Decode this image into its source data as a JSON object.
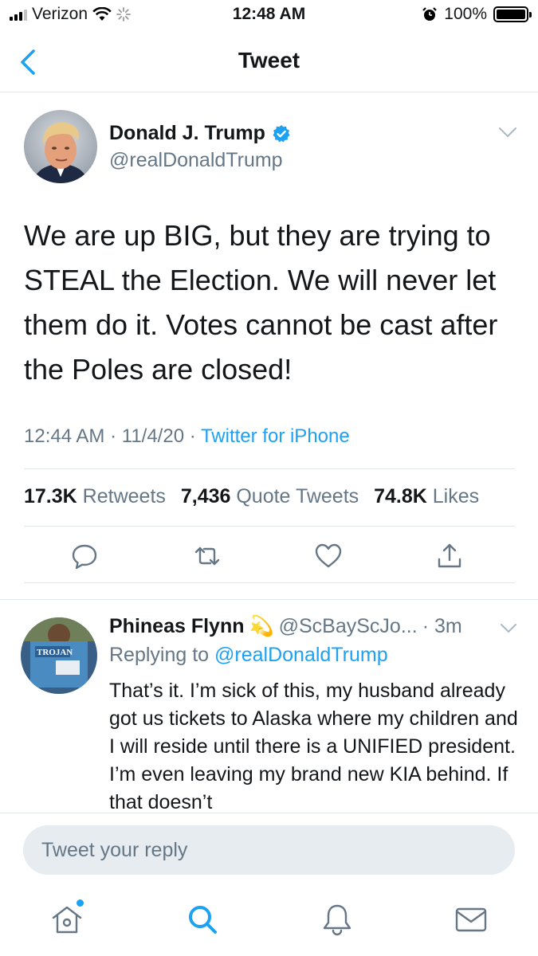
{
  "status_bar": {
    "carrier": "Verizon",
    "time": "12:48 AM",
    "battery": "100%"
  },
  "nav": {
    "title": "Tweet"
  },
  "tweet": {
    "author_name": "Donald J. Trump",
    "author_handle": "@realDonaldTrump",
    "text": "We are up BIG, but they are trying to STEAL the Election. We will never let them do it. Votes cannot be cast after the Poles are closed!",
    "time": "12:44 AM",
    "date": "11/4/20",
    "source": "Twitter for iPhone",
    "retweets_count": "17.3K",
    "retweets_label": "Retweets",
    "quote_count": "7,436",
    "quote_label": "Quote Tweets",
    "likes_count": "74.8K",
    "likes_label": "Likes"
  },
  "reply": {
    "name": "Phineas Flynn",
    "emoji": "💫",
    "handle": "@ScBayScJo...",
    "time": "· 3m",
    "replying_prefix": "Replying to",
    "replying_to": "@realDonaldTrump",
    "text": "That’s it. I’m sick of this, my husband already got us tickets to Alaska where my children and I will reside until there is a UNIFIED president. I’m even leaving my brand new KIA behind. If that doesn’t"
  },
  "compose": {
    "placeholder": "Tweet your reply"
  },
  "colors": {
    "accent": "#1da1f2",
    "secondary_text": "#657786",
    "divider": "#e1e8ed"
  },
  "icons": {
    "tabs": [
      "home-icon",
      "search-icon",
      "notifications-icon",
      "messages-icon"
    ],
    "actions": [
      "reply-icon",
      "retweet-icon",
      "like-icon",
      "share-icon"
    ]
  }
}
